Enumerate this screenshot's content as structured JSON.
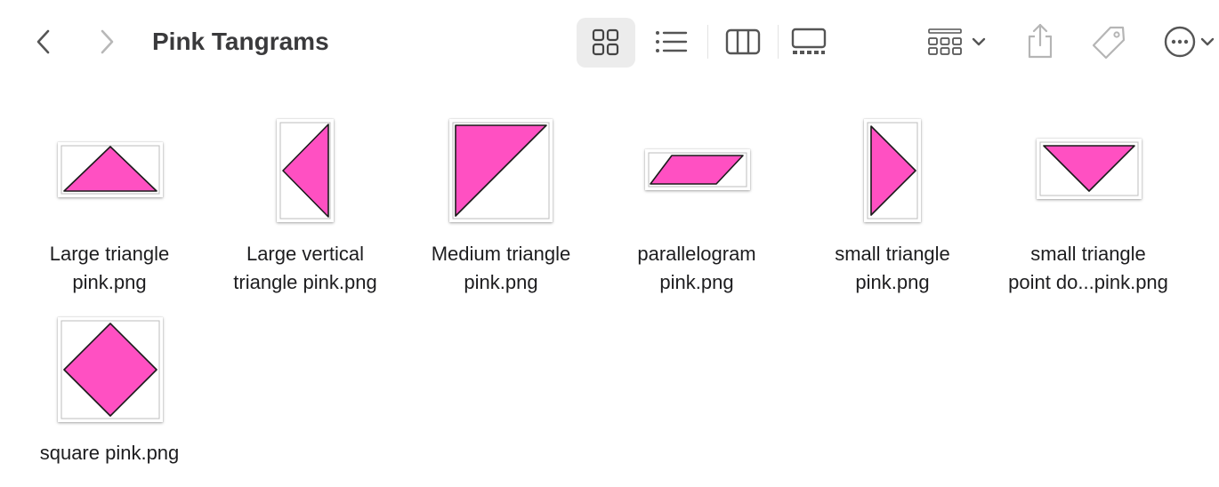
{
  "window": {
    "title": "Pink Tangrams"
  },
  "toolbar": {
    "back": "chevron-left-icon",
    "forward": "chevron-right-icon",
    "views": [
      "icon-view",
      "list-view",
      "column-view",
      "gallery-view"
    ],
    "active_view": "icon-view",
    "group": "group-icon",
    "share": "share-icon",
    "tag": "tag-icon",
    "more": "ellipsis-icon"
  },
  "colors": {
    "shape_fill": "#ff50c2",
    "shape_stroke": "#1a1a1a"
  },
  "files": [
    {
      "line1": "Large triangle",
      "line2": "pink.png"
    },
    {
      "line1": "Large vertical",
      "line2": "triangle pink.png"
    },
    {
      "line1": "Medium triangle",
      "line2": "pink.png"
    },
    {
      "line1": "parallelogram",
      "line2": "pink.png"
    },
    {
      "line1": "small triangle",
      "line2": "pink.png"
    },
    {
      "line1": "small triangle",
      "line2": "point do...pink.png"
    },
    {
      "line1": "square pink.png",
      "line2": ""
    }
  ]
}
